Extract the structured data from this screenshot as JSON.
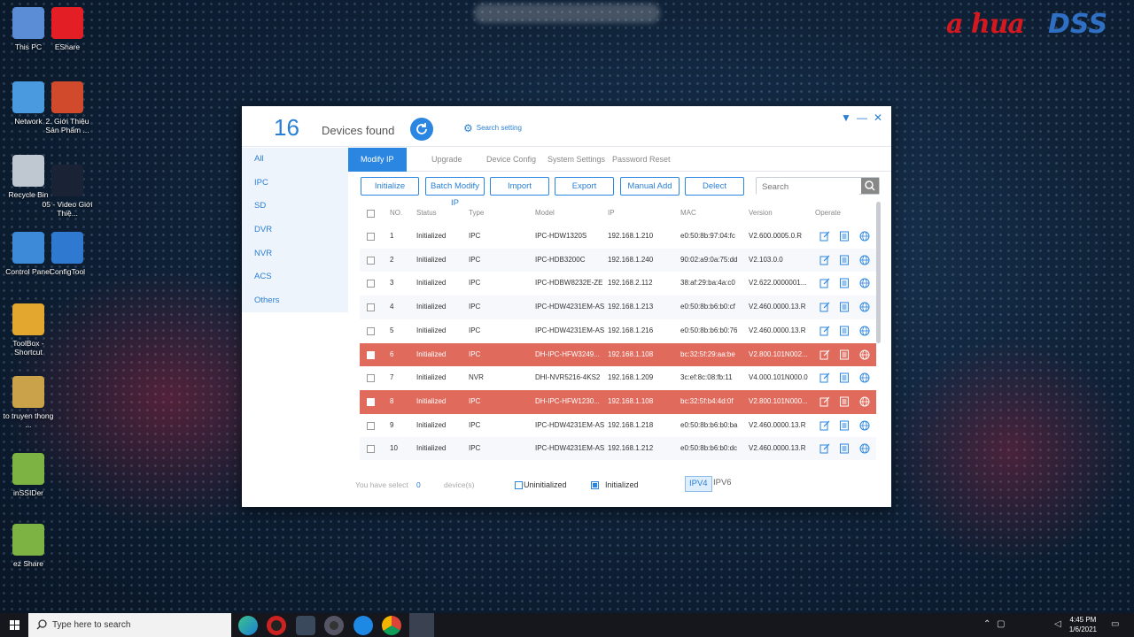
{
  "brand": {
    "left": "a hua",
    "right": "DSS"
  },
  "desktop_icons": [
    {
      "label": "This PC",
      "icon": "pc-icon"
    },
    {
      "label": "EShare",
      "icon": "eshare-icon"
    },
    {
      "label": "Network",
      "icon": "network-icon"
    },
    {
      "label": "2. Giới Thiệu Sản Phẩm ...",
      "icon": "powerpoint-icon"
    },
    {
      "label": "Recycle Bin",
      "icon": "recycle-bin-icon"
    },
    {
      "label": "05 - Video Giới Thiệ...",
      "icon": "video-file-icon"
    },
    {
      "label": "Control Panel",
      "icon": "control-panel-icon"
    },
    {
      "label": "ConfigTool",
      "icon": "configtool-icon"
    },
    {
      "label": "ToolBox - Shortcut",
      "icon": "toolbox-icon"
    },
    {
      "label": "to truyen thong ...",
      "icon": "folder-icon"
    },
    {
      "label": "inSSIDer",
      "icon": "inssider-icon"
    },
    {
      "label": "ez Share",
      "icon": "ezshare-icon"
    }
  ],
  "window": {
    "device_count": "16",
    "devices_found_label": "Devices found",
    "search_setting_label": "Search setting",
    "sidebar": [
      "All",
      "IPC",
      "SD",
      "DVR",
      "NVR",
      "ACS",
      "Others"
    ],
    "tabs": [
      "Modify IP",
      "Upgrade",
      "Device Config",
      "System Settings",
      "Password Reset"
    ],
    "toolbar": [
      "Initialize",
      "Batch Modify IP",
      "Import",
      "Export",
      "Manual Add",
      "Delect"
    ],
    "search_placeholder": "Search",
    "columns": [
      "NO.",
      "Status",
      "Type",
      "Model",
      "IP",
      "MAC",
      "Version",
      "Operate"
    ],
    "rows": [
      {
        "no": "1",
        "status": "Initialized",
        "type": "IPC",
        "model": "IPC-HDW1320S",
        "ip": "192.168.1.210",
        "mac": "e0:50:8b:97:04:fc",
        "version": "V2.600.0005.0.R",
        "error": false
      },
      {
        "no": "2",
        "status": "Initialized",
        "type": "IPC",
        "model": "IPC-HDB3200C",
        "ip": "192.168.1.240",
        "mac": "90:02:a9:0a:75:dd",
        "version": "V2.103.0.0",
        "error": false
      },
      {
        "no": "3",
        "status": "Initialized",
        "type": "IPC",
        "model": "IPC-HDBW8232E-ZE",
        "ip": "192.168.2.112",
        "mac": "38:af:29:ba:4a:c0",
        "version": "V2.622.0000001...",
        "error": false
      },
      {
        "no": "4",
        "status": "Initialized",
        "type": "IPC",
        "model": "IPC-HDW4231EM-AS",
        "ip": "192.168.1.213",
        "mac": "e0:50:8b:b6:b0:cf",
        "version": "V2.460.0000.13.R",
        "error": false
      },
      {
        "no": "5",
        "status": "Initialized",
        "type": "IPC",
        "model": "IPC-HDW4231EM-AS",
        "ip": "192.168.1.216",
        "mac": "e0:50:8b:b6:b0:76",
        "version": "V2.460.0000.13.R",
        "error": false
      },
      {
        "no": "6",
        "status": "Initialized",
        "type": "IPC",
        "model": "DH-IPC-HFW3249...",
        "ip": "192.168.1.108",
        "mac": "bc:32:5f:29:aa:be",
        "version": "V2.800.101N002...",
        "error": true
      },
      {
        "no": "7",
        "status": "Initialized",
        "type": "NVR",
        "model": "DHI-NVR5216-4KS2",
        "ip": "192.168.1.209",
        "mac": "3c:ef:8c:08:fb:11",
        "version": "V4.000.101N000.0",
        "error": false
      },
      {
        "no": "8",
        "status": "Initialized",
        "type": "IPC",
        "model": "DH-IPC-HFW1230...",
        "ip": "192.168.1.108",
        "mac": "bc:32:5f:b4:4d:0f",
        "version": "V2.800.101N000...",
        "error": true
      },
      {
        "no": "9",
        "status": "Initialized",
        "type": "IPC",
        "model": "IPC-HDW4231EM-AS",
        "ip": "192.168.1.218",
        "mac": "e0:50:8b:b6:b0:ba",
        "version": "V2.460.0000.13.R",
        "error": false
      },
      {
        "no": "10",
        "status": "Initialized",
        "type": "IPC",
        "model": "IPC-HDW4231EM-AS",
        "ip": "192.168.1.212",
        "mac": "e0:50:8b:b6:b0:dc",
        "version": "V2.460.0000.13.R",
        "error": false
      }
    ],
    "footer": {
      "you_have_select": "You have select",
      "selected_count": "0",
      "devices_suffix": "device(s)",
      "uninitialized_label": "Uninitialized",
      "initialized_label": "Initialized",
      "ipv4": "IPV4",
      "ipv6": "IPV6"
    },
    "colors": {
      "accent": "#2a86e0",
      "error_row": "#e06a5c",
      "sidebar_bg": "#eef4fc"
    }
  },
  "taskbar": {
    "search_placeholder": "Type here to search",
    "apps": [
      "edge-icon",
      "record-icon",
      "weather-icon",
      "camera-icon",
      "ie-icon",
      "chrome-icon",
      "configtool-icon"
    ],
    "time": "4:45 PM",
    "date": "1/6/2021"
  }
}
